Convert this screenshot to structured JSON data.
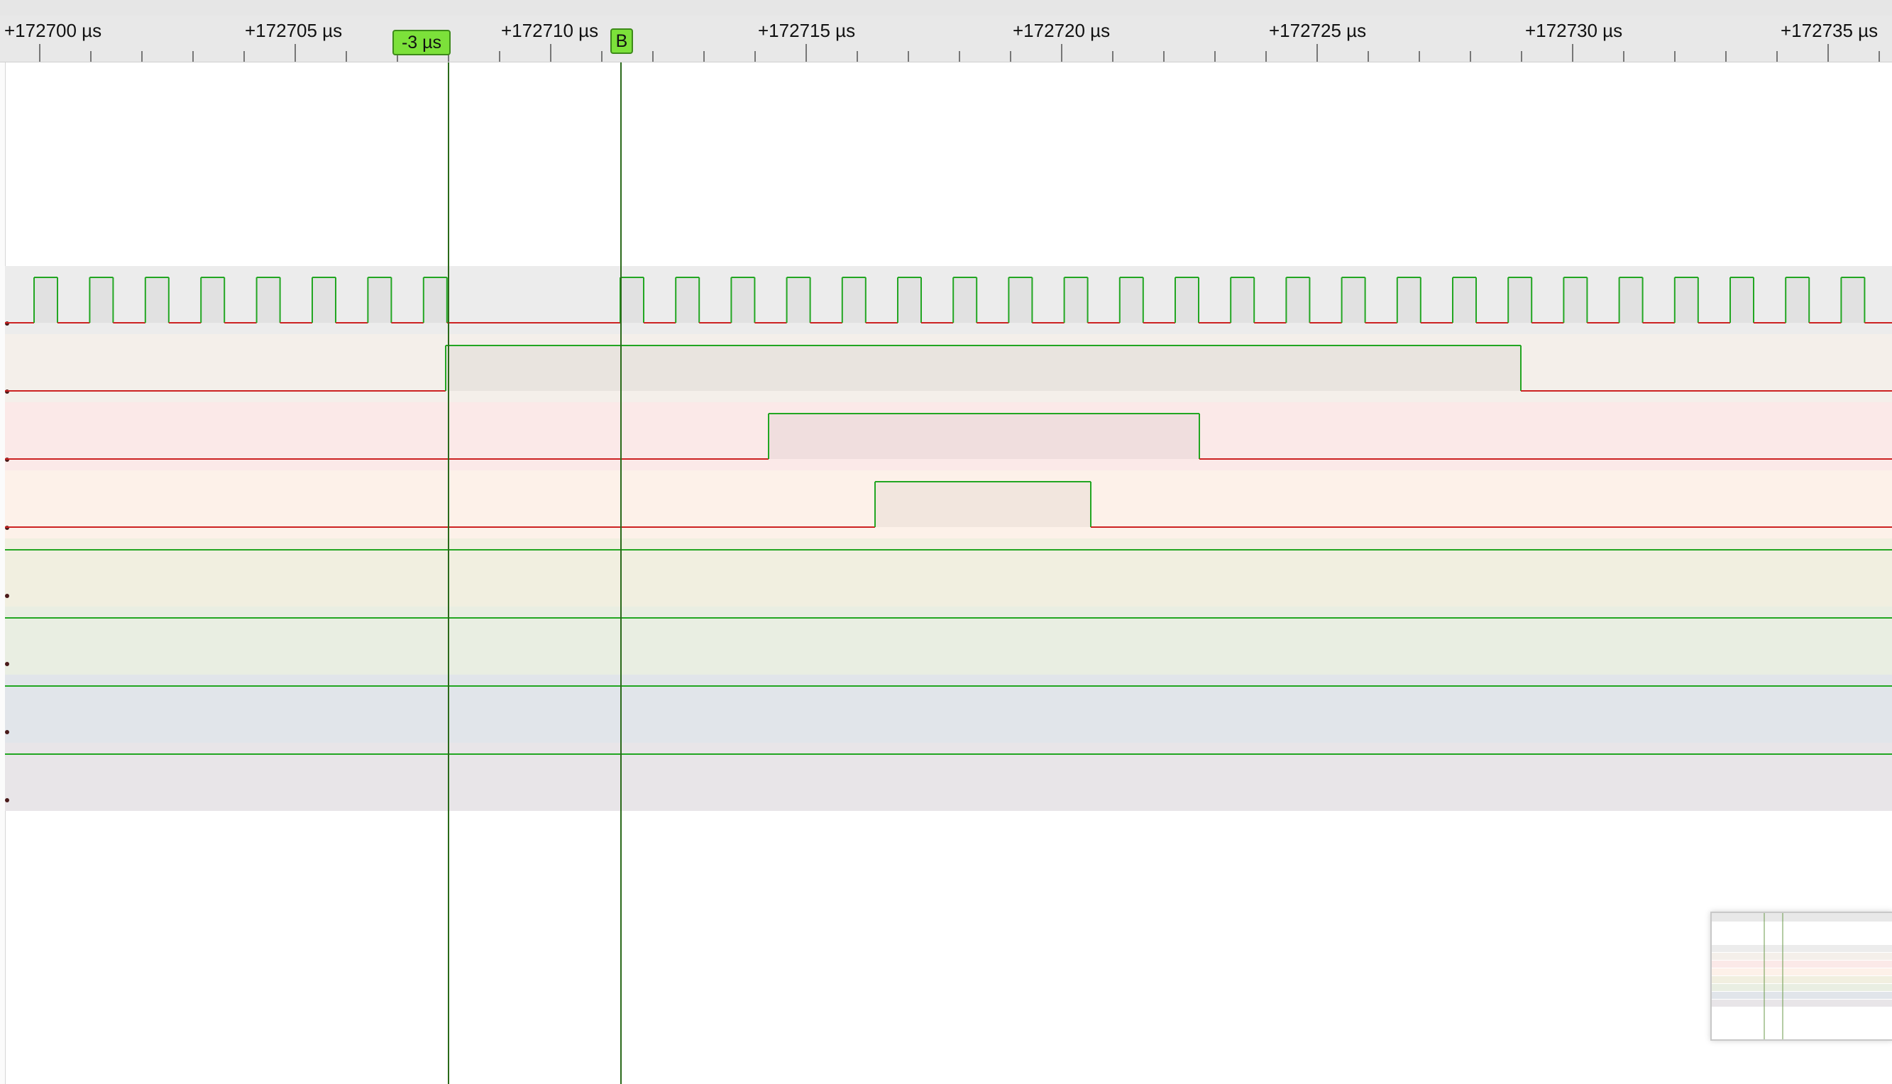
{
  "ruler": {
    "labels": [
      "+172700 µs",
      "+172705 µs",
      "+172710 µs",
      "+172715 µs",
      "+172720 µs",
      "+172725 µs",
      "+172730 µs",
      "+172735 µs"
    ]
  },
  "cursors": {
    "a_label": "-3 µs",
    "b_label": "B"
  },
  "colors": {
    "low_trace": "#cc2222",
    "high_trace": "#22a622",
    "cursor_line": "#2a6a1a",
    "cursor_flag": "#7ce13a"
  },
  "channels": [
    {
      "lane_color": "#ececec",
      "signal": "clock"
    },
    {
      "lane_color": "#f4efea",
      "signal": "pulse"
    },
    {
      "lane_color": "#fbe9e8",
      "signal": "pulse"
    },
    {
      "lane_color": "#fdf1e9",
      "signal": "pulse"
    },
    {
      "lane_color": "#f1efe0",
      "signal": "high"
    },
    {
      "lane_color": "#e9eee2",
      "signal": "high"
    },
    {
      "lane_color": "#e1e5ea",
      "signal": "high"
    },
    {
      "lane_color": "#e8e5e8",
      "signal": "high"
    }
  ],
  "minimap": {
    "icon": "overview-minimap"
  }
}
